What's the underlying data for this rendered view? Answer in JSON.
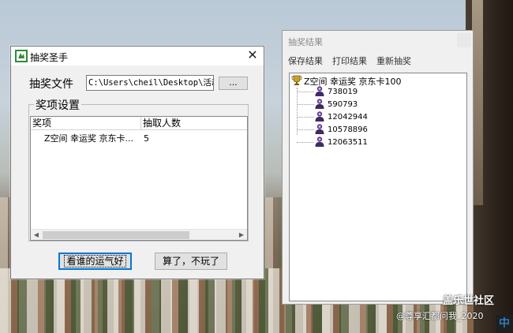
{
  "main_dialog": {
    "title": "抽奖圣手",
    "file_label": "抽奖文件",
    "file_path": "C:\\Users\\cheil\\Desktop\\活动抽",
    "browse_label": "...",
    "group_title": "奖项设置",
    "columns": [
      "奖项",
      "抽取人数"
    ],
    "rows": [
      {
        "prize": "Z空间 幸运奖 京东卡...",
        "count": "5"
      }
    ],
    "start_button": "看谁的运气好",
    "quit_button": "算了，不玩了"
  },
  "result_window": {
    "title": "抽奖结果",
    "menu": [
      "保存结果",
      "打印结果",
      "重新抽奖"
    ],
    "tree_root": "Z空间 幸运奖 京东卡100",
    "winners": [
      "738019",
      "590793",
      "12042944",
      "10578896",
      "12063511"
    ]
  },
  "watermark": {
    "brand": "盖乐世社区",
    "author": "@尊享汇都问我_2020"
  },
  "ime_indicator": "中",
  "colors": {
    "dialog_bg": "#f0f0f0",
    "default_button_border": "#0078d7",
    "app_icon_green": "#2e8b3a"
  }
}
